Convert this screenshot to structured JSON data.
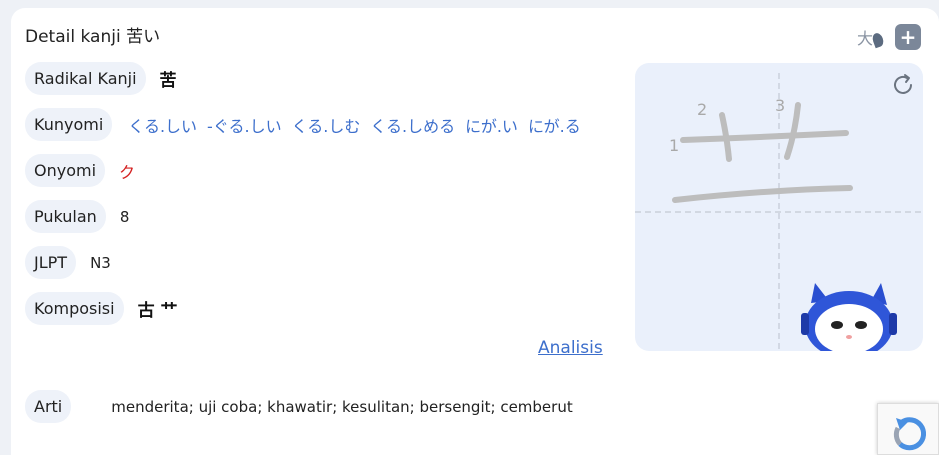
{
  "header": {
    "title": "Detail kanji 苦い",
    "font_size_icon_label": "大",
    "add_label": "+"
  },
  "rows": {
    "radikal": {
      "label": "Radikal Kanji",
      "value": "苦"
    },
    "kunyomi": {
      "label": "Kunyomi",
      "values": [
        "くる.しい",
        "-ぐる.しい",
        "くる.しむ",
        "くる.しめる",
        "にが.い",
        "にが.る"
      ]
    },
    "onyomi": {
      "label": "Onyomi",
      "value": "ク"
    },
    "pukulan": {
      "label": "Pukulan",
      "value": "8"
    },
    "jlpt": {
      "label": "JLPT",
      "value": "N3"
    },
    "komposisi": {
      "label": "Komposisi",
      "value": "古 艹"
    },
    "arti": {
      "label": "Arti",
      "value": "menderita; uji coba; khawatir; kesulitan; bersengit; cemberut"
    }
  },
  "analisis_link": "Analisis",
  "stroke_panel": {
    "stroke_numbers": [
      "1",
      "2",
      "3"
    ]
  },
  "colors": {
    "accent_blue": "#3d6fcc",
    "onyomi_red": "#d42020",
    "pill_bg": "#eef2f9"
  }
}
